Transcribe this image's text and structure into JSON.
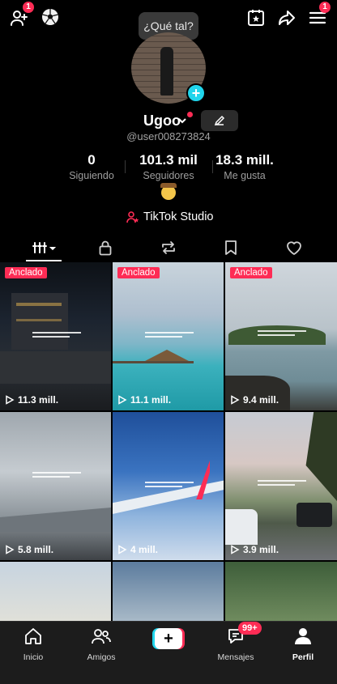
{
  "topbar": {
    "add_friends_badge": "1",
    "menu_badge": "1"
  },
  "tooltip": "¿Qué tal?",
  "profile": {
    "username": "Ugoo",
    "handle": "@user008273824"
  },
  "stats": [
    {
      "value": "0",
      "label": "Siguiendo"
    },
    {
      "value": "101.3 mil",
      "label": "Seguidores"
    },
    {
      "value": "18.3 mill.",
      "label": "Me gusta"
    }
  ],
  "studio_link": "TikTok Studio",
  "videos": [
    {
      "pinned": "Anclado",
      "views": "11.3 mill."
    },
    {
      "pinned": "Anclado",
      "views": "11.1 mill."
    },
    {
      "pinned": "Anclado",
      "views": "9.4 mill."
    },
    {
      "pinned": "",
      "views": "5.8 mill."
    },
    {
      "pinned": "",
      "views": "4 mill."
    },
    {
      "pinned": "",
      "views": "3.9 mill."
    }
  ],
  "nav": {
    "home": "Inicio",
    "friends": "Amigos",
    "messages": "Mensajes",
    "messages_badge": "99+",
    "profile": "Perfil"
  },
  "colors": {
    "accent_red": "#fe2c55",
    "accent_cyan": "#20d5ec"
  }
}
